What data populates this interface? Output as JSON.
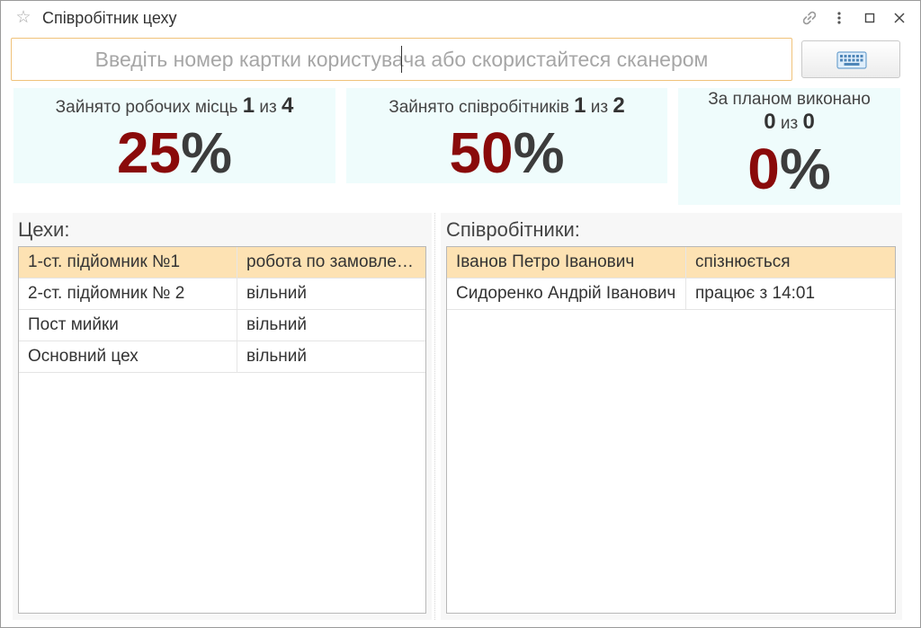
{
  "window": {
    "title": "Співробітник цеху"
  },
  "search": {
    "placeholder": "Введіть номер картки користувача або скористайтеся сканером",
    "value": ""
  },
  "stats": [
    {
      "label": "Зайнято робочих місць",
      "count": "1",
      "sep": "из",
      "total": "4",
      "percent_num": "25",
      "percent_sign": "%",
      "percent": 25
    },
    {
      "label": "Зайнято співробітників",
      "count": "1",
      "sep": "из",
      "total": "2",
      "percent_num": "50",
      "percent_sign": "%",
      "percent": 50
    },
    {
      "label": "За планом виконано",
      "count": "0",
      "sep": "из",
      "total": "0",
      "percent_num": "0",
      "percent_sign": "%",
      "percent": 0
    }
  ],
  "workshops": {
    "title": "Цехи:",
    "rows": [
      {
        "name": "1-ст. підйомник №1",
        "status": "робота по замовленню",
        "selected": true
      },
      {
        "name": "2-ст. підйомник № 2",
        "status": "вільний",
        "selected": false
      },
      {
        "name": "Пост мийки",
        "status": "вільний",
        "selected": false
      },
      {
        "name": "Основний цех",
        "status": "вільний",
        "selected": false
      }
    ]
  },
  "employees": {
    "title": "Співробітники:",
    "rows": [
      {
        "name": "Іванов Петро Іванович",
        "status": "спізнюється",
        "selected": true
      },
      {
        "name": "Сидоренко Андрій Іванович",
        "status": "працює з 14:01",
        "selected": false
      }
    ]
  },
  "colors": {
    "accent_percent": "#8a0a0a",
    "selected_row": "#fde2b3",
    "stat_bg": "#effcfc",
    "search_border": "#f0c27a"
  },
  "icons": {
    "star": "star-icon",
    "link": "link-icon",
    "more": "more-vertical-icon",
    "maximize": "maximize-icon",
    "close": "close-icon",
    "keyboard": "keyboard-icon"
  }
}
